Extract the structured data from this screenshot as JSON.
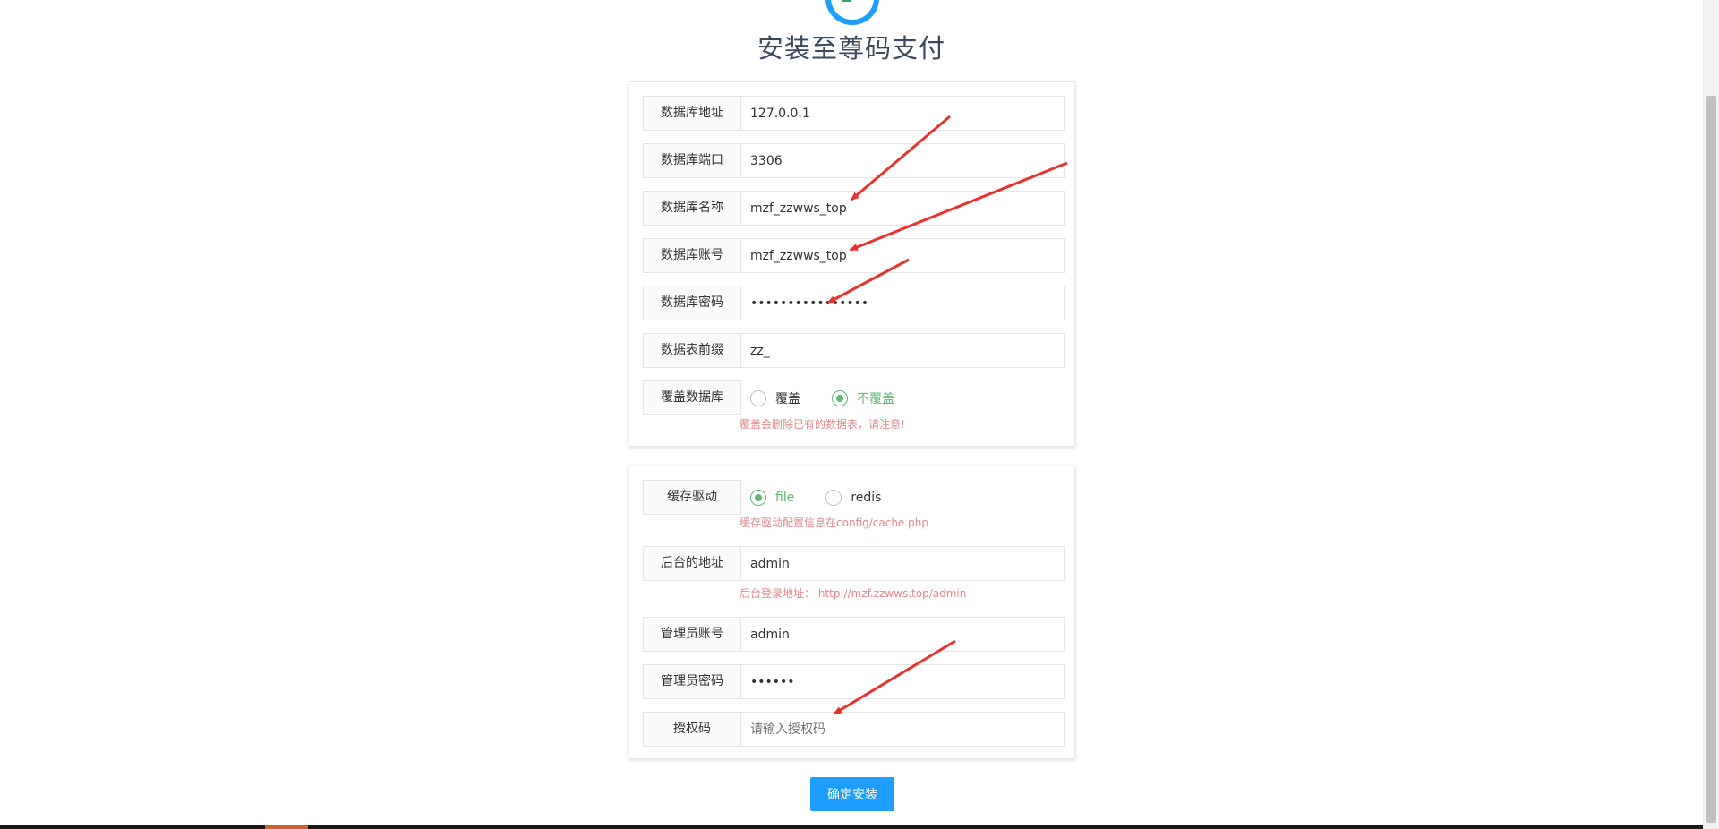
{
  "page": {
    "title": "安装至尊码支付",
    "submit_label": "确定安装"
  },
  "database": {
    "host": {
      "label": "数据库地址",
      "value": "127.0.0.1"
    },
    "port": {
      "label": "数据库端口",
      "value": "3306"
    },
    "name": {
      "label": "数据库名称",
      "value": "mzf_zzwws_top"
    },
    "user": {
      "label": "数据库账号",
      "value": "mzf_zzwws_top"
    },
    "password": {
      "label": "数据库密码",
      "value": "••••••••••••••••"
    },
    "prefix": {
      "label": "数据表前缀",
      "value": "zz_"
    },
    "overwrite": {
      "label": "覆盖数据库",
      "options": [
        "覆盖",
        "不覆盖"
      ],
      "selected": "不覆盖",
      "hint": "覆盖会删除已有的数据表，请注意!"
    }
  },
  "admin": {
    "cache": {
      "label": "缓存驱动",
      "options": [
        "file",
        "redis"
      ],
      "selected": "file",
      "hint": "缓存驱动配置信息在config/cache.php"
    },
    "admin_path": {
      "label": "后台的地址",
      "value": "admin",
      "hint": "后台登录地址： http://mzf.zzwws.top/admin"
    },
    "admin_user": {
      "label": "管理员账号",
      "value": "admin"
    },
    "admin_password": {
      "label": "管理员密码",
      "value": "••••••"
    },
    "license": {
      "label": "授权码",
      "placeholder": "请输入授权码"
    }
  },
  "colors": {
    "accent_green": "#5fb878",
    "primary_blue": "#1e9fff",
    "hint_red": "#e08b8b",
    "arrow_red": "#e8322d"
  }
}
